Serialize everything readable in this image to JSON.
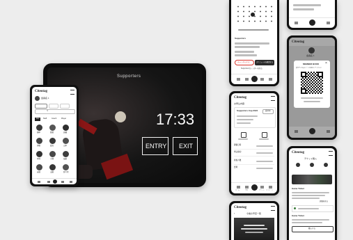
{
  "accent": "#d9342b",
  "kiosk": {
    "logo": "Supporters",
    "time": "17:33",
    "entry_label": "ENTRY",
    "exit_label": "EXIT"
  },
  "phone_small": {
    "logo": "Citeotag",
    "section": "会員名 1",
    "tabs": [
      "ALL",
      "Staff",
      "Coach",
      "Player"
    ],
    "members": [
      "田中",
      "佐藤",
      "高橋",
      "伊藤",
      "渡辺",
      "山本",
      "中村",
      "小林",
      "加藤",
      "吉田",
      "山田",
      "佐々木"
    ]
  },
  "phone_top": {
    "label": "Supporters",
    "button_red": "キャンセルする",
    "button_dark": "スケジュールを確認する",
    "link": "Supportersカレンダーを見る"
  },
  "phone_middle": {
    "logo": "Citeotag",
    "section": "お申込内容",
    "event_title": "Supporters Cup 2024",
    "status": "受付中",
    "row_labels": [
      "開催日時",
      "申込締切",
      "参加人数",
      "会場"
    ],
    "menu": [
      "ホーム",
      "予約",
      "チケット",
      "マイページ"
    ]
  },
  "phone_qr": {
    "logo": "Citeotag",
    "member_name": "会員名 1",
    "card_title": "MEMBER BOOK",
    "card_note": "受付でこのQRコードを提示してください"
  },
  "phone_brs": {
    "logo": "Citeotag",
    "header": "チケット購入",
    "card_title": "Game Ticket",
    "link": "詳細を見る",
    "button": "購入する"
  },
  "phone_bottom": {
    "logo": "Citeotag",
    "header": "今後の予定一覧"
  }
}
